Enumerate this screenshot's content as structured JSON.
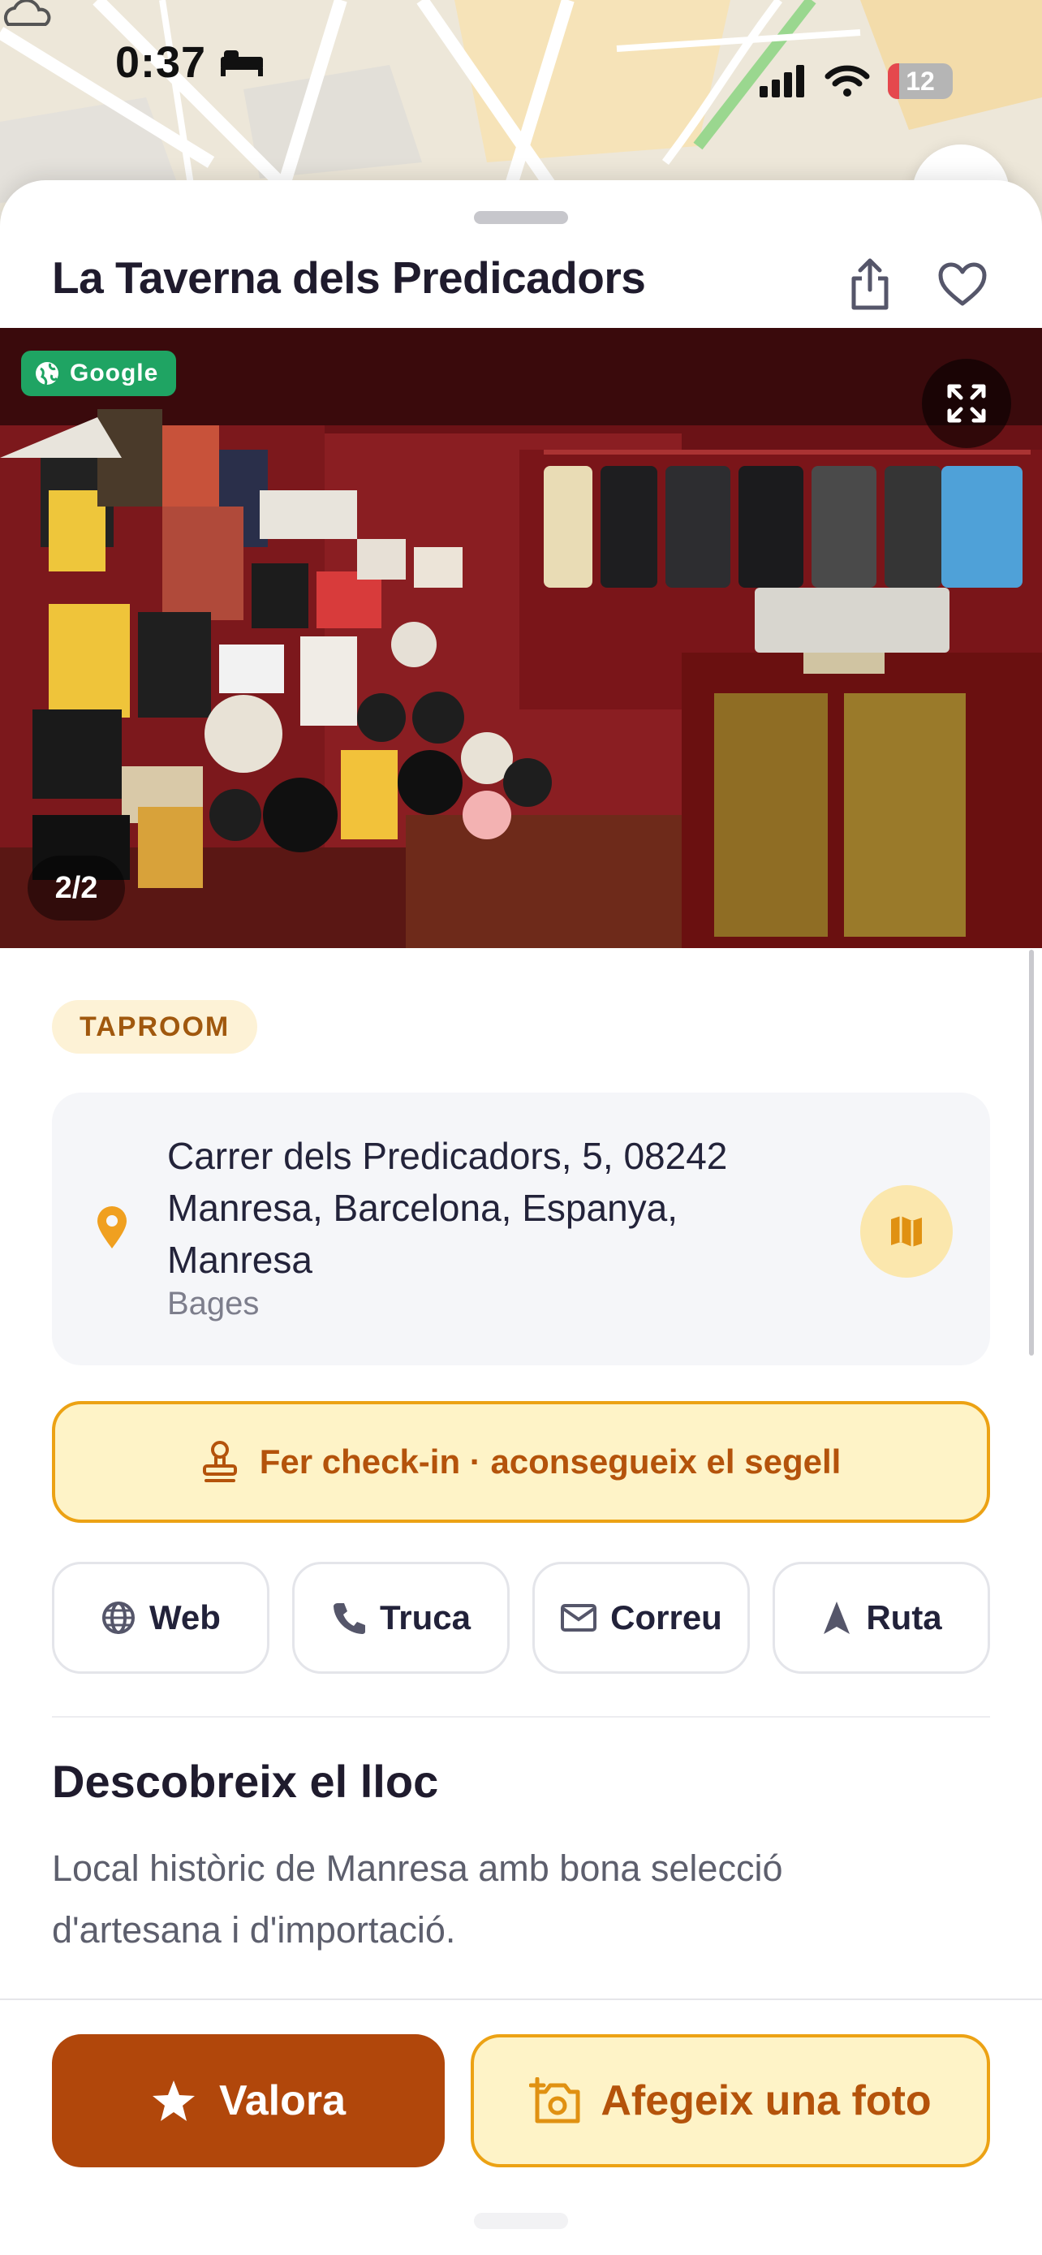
{
  "status_bar": {
    "time": "0:37",
    "battery": "12"
  },
  "place": {
    "title": "La Taverna dels Predicadors",
    "photo_source": "Google",
    "photo_counter": "2/2",
    "category_tag": "TAPROOM",
    "address_lines": [
      "Carrer dels Predicadors, 5, 08242",
      "Manresa, Barcelona, Espanya,",
      "Manresa"
    ],
    "region": "Bages"
  },
  "checkin": {
    "label": "Fer check-in · aconsegueix el segell"
  },
  "actions": [
    {
      "label": "Web",
      "icon": "globe-icon"
    },
    {
      "label": "Truca",
      "icon": "phone-icon"
    },
    {
      "label": "Correu",
      "icon": "mail-icon"
    },
    {
      "label": "Ruta",
      "icon": "navigation-arrow-icon"
    }
  ],
  "section": {
    "title": "Descobreix el lloc",
    "body": "Local històric de Manresa amb bona selecció d'artesana i d'importació."
  },
  "bottom": {
    "rate_label": "Valora",
    "photo_label": "Afegeix una foto"
  },
  "colors": {
    "accent": "#b1470b",
    "accent_soft": "#fef3c7",
    "accent_border": "#eca214",
    "google_green": "#1fa463",
    "pin": "#f0a020"
  }
}
